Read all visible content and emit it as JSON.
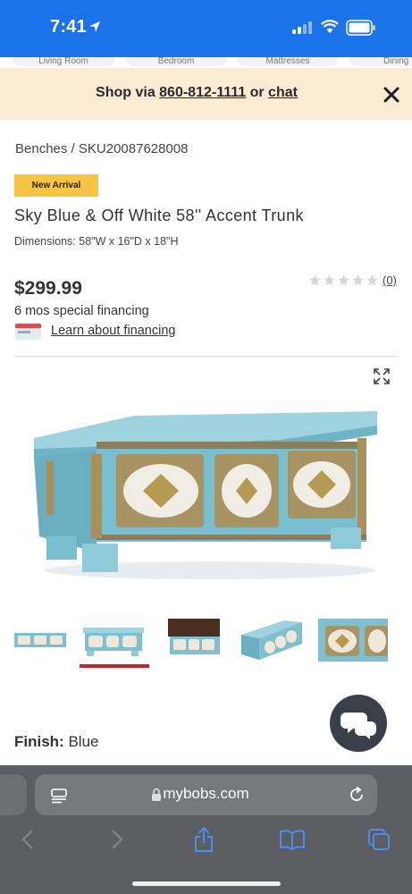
{
  "status_bar": {
    "time": "7:41"
  },
  "categories": [
    "Living Room",
    "Bedroom",
    "Mattresses",
    "Dining"
  ],
  "promo": {
    "prefix": "Shop via ",
    "phone": "860-812-1111",
    "middle": " or ",
    "chat": "chat"
  },
  "breadcrumb": {
    "category": "Benches",
    "separator": "/",
    "sku": "SKU20087628008"
  },
  "badge": "New Arrival",
  "product": {
    "title": "Sky Blue & Off White 58'' Accent Trunk",
    "dimensions": "Dimensions: 58\"W x 16\"D x 18\"H",
    "price": "$299.99",
    "review_count": "(0)",
    "rating": 0,
    "financing_line": "6 mos special financing",
    "financing_link": "Learn about financing"
  },
  "gallery": {
    "thumbnail_count": 5,
    "selected_index": 1
  },
  "finish": {
    "label": "Finish:",
    "value": "Blue"
  },
  "browser": {
    "url": "mybobs.com"
  },
  "colors": {
    "brand_blue": "#1a73e8",
    "promo_bg": "#fbebd5",
    "badge_yellow": "#f7c443",
    "selected_red": "#c0272d",
    "toolbar_gray": "#5b5d61",
    "icon_blue": "#4a8cf0"
  }
}
